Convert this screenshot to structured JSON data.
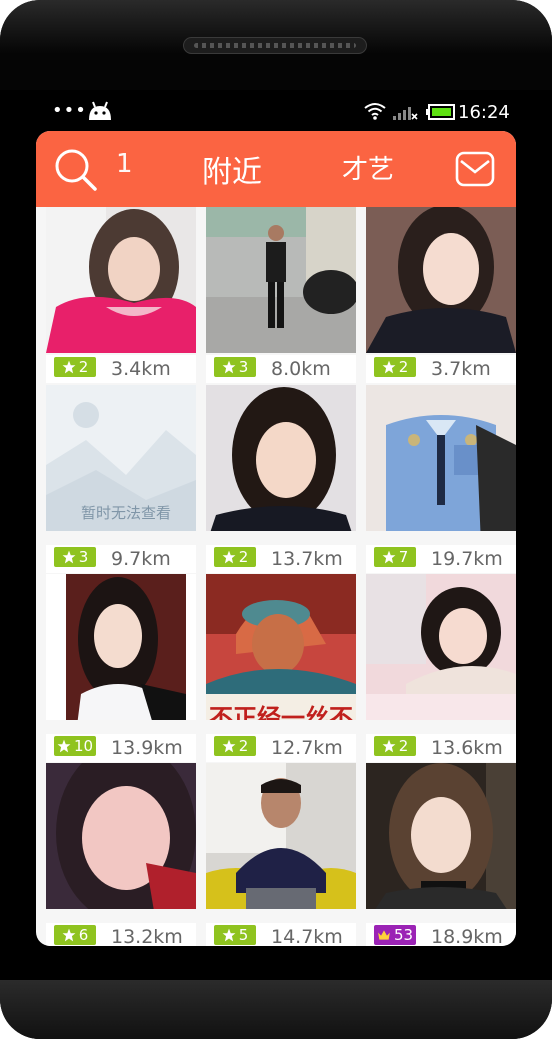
{
  "status_bar": {
    "time": "16:24"
  },
  "header": {
    "search_icon": "search-icon",
    "tab_left": "1",
    "tab_active": "附近",
    "tab_right": "才艺",
    "mail_icon": "mail-icon",
    "accent_color": "#fb6442"
  },
  "users": [
    {
      "level": "2",
      "distance": "3.4km",
      "badge_icon": "star-icon",
      "badge_color": "#8fc31f"
    },
    {
      "level": "3",
      "distance": "8.0km",
      "badge_icon": "star-icon",
      "badge_color": "#8fc31f"
    },
    {
      "level": "2",
      "distance": "3.7km",
      "badge_icon": "star-icon",
      "badge_color": "#8fc31f"
    },
    {
      "level": "3",
      "distance": "9.7km",
      "badge_icon": "star-icon",
      "badge_color": "#8fc31f",
      "photo_text": "暂时无法查看"
    },
    {
      "level": "2",
      "distance": "13.7km",
      "badge_icon": "star-icon",
      "badge_color": "#8fc31f"
    },
    {
      "level": "7",
      "distance": "19.7km",
      "badge_icon": "star-icon",
      "badge_color": "#8fc31f"
    },
    {
      "level": "10",
      "distance": "13.9km",
      "badge_icon": "star-icon",
      "badge_color": "#8fc31f"
    },
    {
      "level": "2",
      "distance": "12.7km",
      "badge_icon": "star-icon",
      "badge_color": "#8fc31f",
      "photo_text": "不正经一丝不"
    },
    {
      "level": "2",
      "distance": "13.6km",
      "badge_icon": "star-icon",
      "badge_color": "#8fc31f"
    },
    {
      "level": "6",
      "distance": "13.2km",
      "badge_icon": "star-icon",
      "badge_color": "#8fc31f"
    },
    {
      "level": "5",
      "distance": "14.7km",
      "badge_icon": "star-icon",
      "badge_color": "#8fc31f"
    },
    {
      "level": "53",
      "distance": "18.9km",
      "badge_icon": "crown-icon",
      "badge_color": "#9b23b5"
    }
  ]
}
